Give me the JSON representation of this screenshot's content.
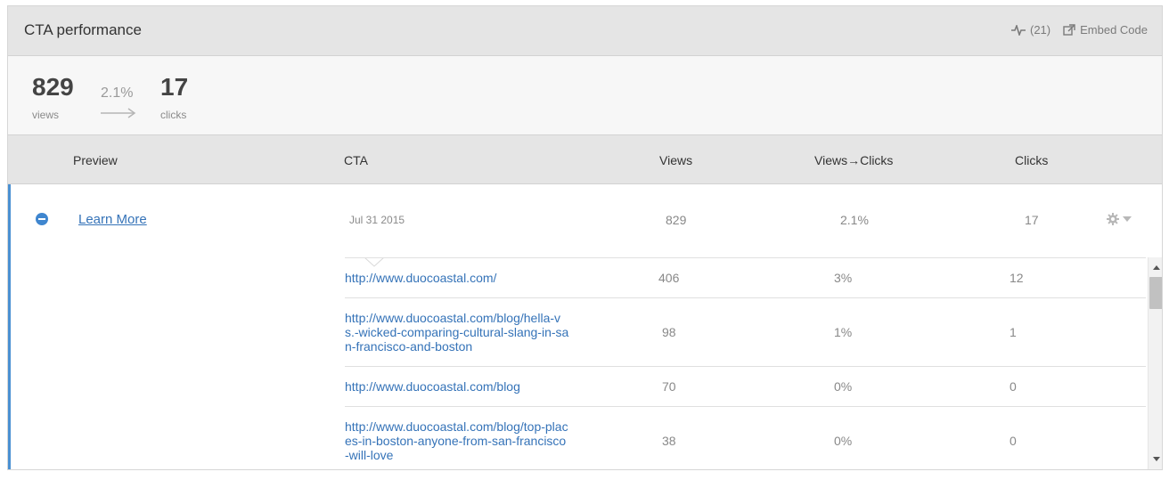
{
  "header": {
    "title": "CTA performance",
    "activity_count": "(21)",
    "embed_label": "Embed Code"
  },
  "summary": {
    "views": "829",
    "views_label": "views",
    "rate": "2.1%",
    "clicks": "17",
    "clicks_label": "clicks"
  },
  "columns": {
    "preview": "Preview",
    "cta": "CTA",
    "views": "Views",
    "views_clicks": "Views→Clicks",
    "clicks": "Clicks"
  },
  "cta_row": {
    "name": "Learn More",
    "date": "Jul 31 2015",
    "views": "829",
    "rate": "2.1%",
    "clicks": "17"
  },
  "url_rows": [
    {
      "url": "http://www.duocoastal.com/",
      "views": "406",
      "rate": "3%",
      "clicks": "12"
    },
    {
      "url": "http://www.duocoastal.com/blog/hella-vs.-wicked-comparing-cultural-slang-in-san-francisco-and-boston",
      "views": "98",
      "rate": "1%",
      "clicks": "1"
    },
    {
      "url": "http://www.duocoastal.com/blog",
      "views": "70",
      "rate": "0%",
      "clicks": "0"
    },
    {
      "url": "http://www.duocoastal.com/blog/top-places-in-boston-anyone-from-san-francisco-will-love",
      "views": "38",
      "rate": "0%",
      "clicks": "0"
    }
  ],
  "colors": {
    "accent": "#4a90d2",
    "link": "#3573b8",
    "header_bg": "#e5e5e5",
    "summary_bg": "#f7f7f7"
  },
  "icons": {
    "activity": "activity-pulse-icon",
    "embed": "external-link-icon",
    "collapse": "minus-circle-icon",
    "settings": "gear-icon"
  }
}
